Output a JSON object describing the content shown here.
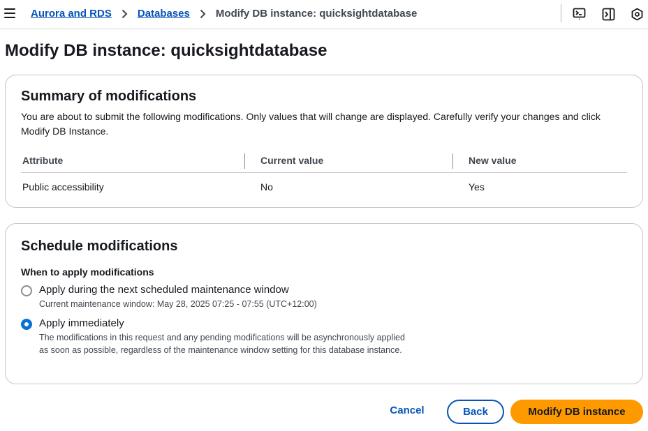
{
  "breadcrumb": {
    "items": [
      "Aurora and RDS",
      "Databases"
    ],
    "current": "Modify DB instance: quicksightdatabase"
  },
  "toolbar_icons": [
    "terminal-icon",
    "side-panel-icon",
    "settings-hex-icon"
  ],
  "page_title": "Modify DB instance: quicksightdatabase",
  "summary": {
    "title": "Summary of modifications",
    "description": "You are about to submit the following modifications. Only values that will change are displayed. Carefully verify your changes and click Modify DB Instance.",
    "columns": [
      "Attribute",
      "Current value",
      "New value"
    ],
    "rows": [
      [
        "Public accessibility",
        "No",
        "Yes"
      ]
    ]
  },
  "schedule": {
    "title": "Schedule modifications",
    "question": "When to apply modifications",
    "options": [
      {
        "label": "Apply during the next scheduled maintenance window",
        "description": "Current maintenance window: May 28, 2025 07:25 - 07:55 (UTC+12:00)",
        "selected": false
      },
      {
        "label": "Apply immediately",
        "description": "The modifications in this request and any pending modifications will be asynchronously applied as soon as possible, regardless of the maintenance window setting for this database instance.",
        "selected": true
      }
    ]
  },
  "actions": {
    "cancel": "Cancel",
    "back": "Back",
    "submit": "Modify DB instance"
  },
  "colors": {
    "link": "#0654b8",
    "primary_button": "#ff9900",
    "radio_selected": "#0972d3"
  }
}
